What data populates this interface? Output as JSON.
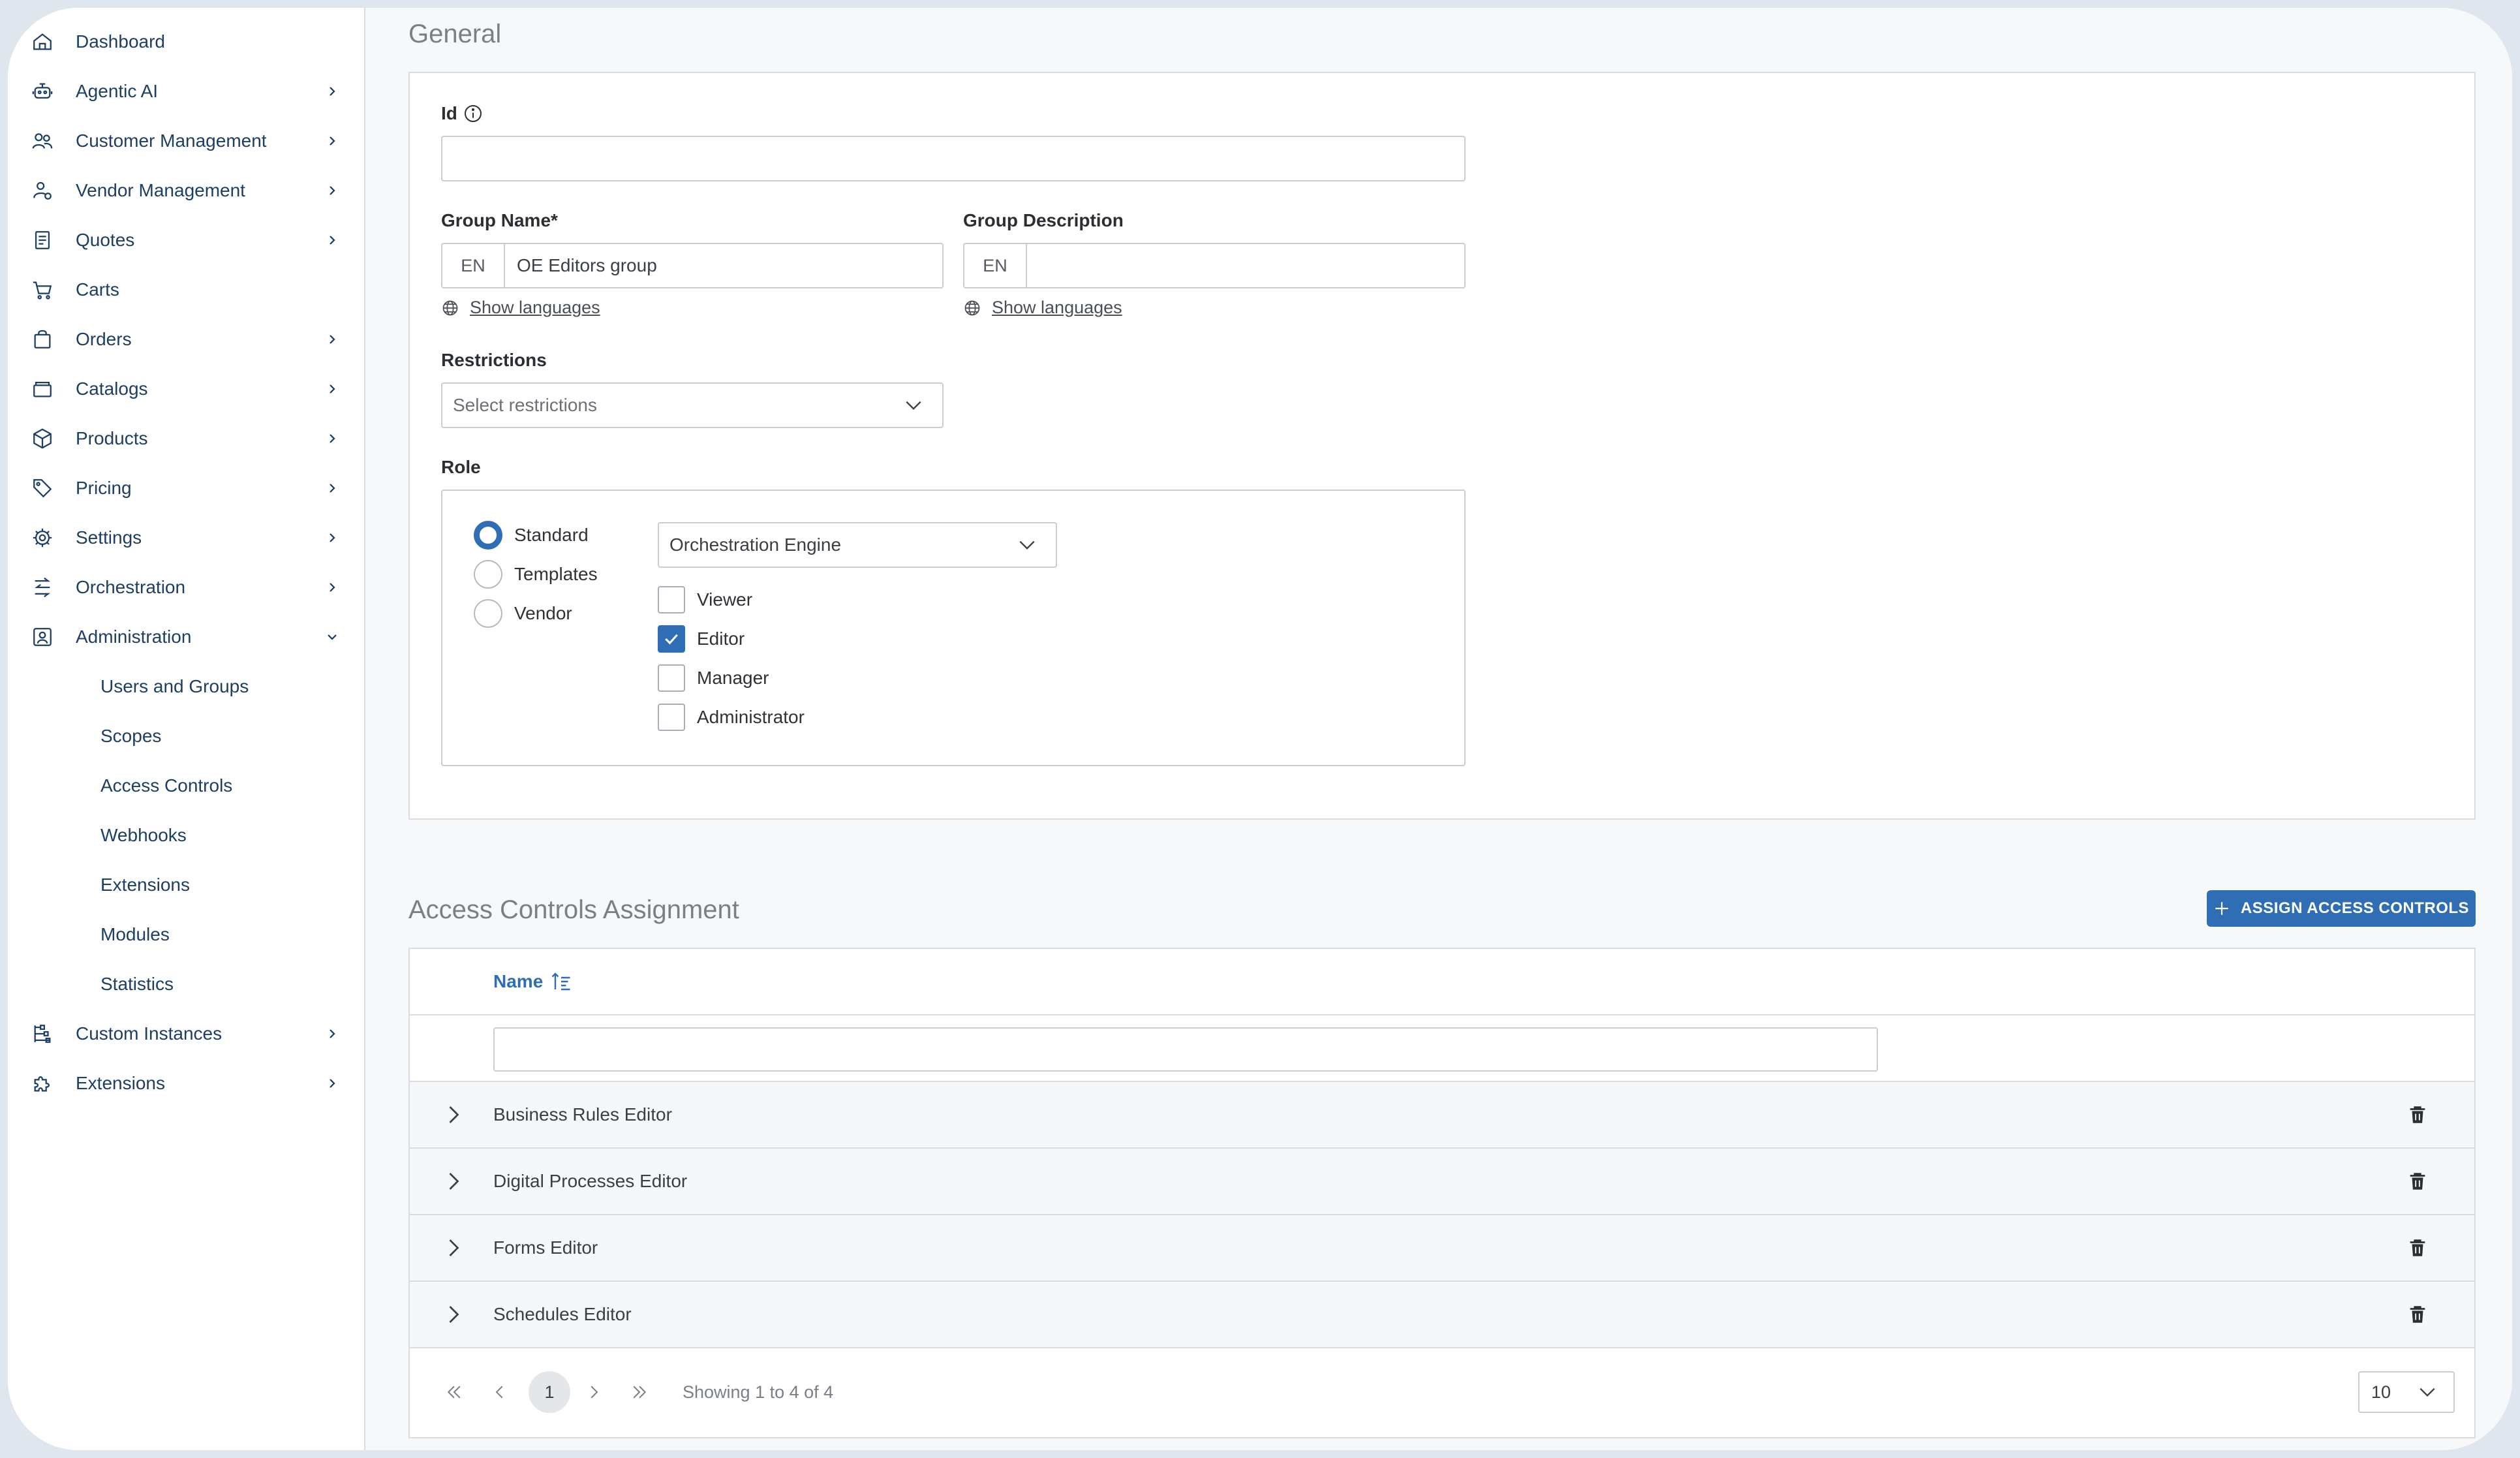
{
  "sidebar": {
    "items": [
      {
        "label": "Dashboard",
        "icon": "home-icon",
        "has_children": false
      },
      {
        "label": "Agentic AI",
        "icon": "robot-icon",
        "has_children": true
      },
      {
        "label": "Customer Management",
        "icon": "users-icon",
        "has_children": true
      },
      {
        "label": "Vendor Management",
        "icon": "vendor-icon",
        "has_children": true
      },
      {
        "label": "Quotes",
        "icon": "document-icon",
        "has_children": true
      },
      {
        "label": "Carts",
        "icon": "cart-icon",
        "has_children": false
      },
      {
        "label": "Orders",
        "icon": "bag-icon",
        "has_children": true
      },
      {
        "label": "Catalogs",
        "icon": "catalog-icon",
        "has_children": true
      },
      {
        "label": "Products",
        "icon": "box-icon",
        "has_children": true
      },
      {
        "label": "Pricing",
        "icon": "tag-icon",
        "has_children": true
      },
      {
        "label": "Settings",
        "icon": "gear-icon",
        "has_children": true
      },
      {
        "label": "Orchestration",
        "icon": "orchestration-icon",
        "has_children": true
      },
      {
        "label": "Administration",
        "icon": "admin-icon",
        "has_children": true,
        "expanded": true
      }
    ],
    "admin_subitems": [
      "Users and Groups",
      "Scopes",
      "Access Controls",
      "Webhooks",
      "Extensions",
      "Modules",
      "Statistics"
    ],
    "bottom_items": [
      {
        "label": "Custom Instances",
        "icon": "hierarchy-icon",
        "has_children": true
      },
      {
        "label": "Extensions",
        "icon": "puzzle-icon",
        "has_children": true
      }
    ]
  },
  "general": {
    "title": "General",
    "id_label": "Id",
    "id_value": "",
    "group_name_label": "Group Name*",
    "group_name_lang": "EN",
    "group_name_value": "OE Editors group",
    "group_desc_label": "Group Description",
    "group_desc_lang": "EN",
    "group_desc_value": "",
    "show_languages": "Show languages",
    "restrictions_label": "Restrictions",
    "restrictions_placeholder": "Select restrictions",
    "role_label": "Role",
    "role_options": [
      {
        "label": "Standard",
        "checked": true
      },
      {
        "label": "Templates",
        "checked": false
      },
      {
        "label": "Vendor",
        "checked": false
      }
    ],
    "role_module": "Orchestration Engine",
    "permissions": [
      {
        "label": "Viewer",
        "checked": false
      },
      {
        "label": "Editor",
        "checked": true
      },
      {
        "label": "Manager",
        "checked": false
      },
      {
        "label": "Administrator",
        "checked": false
      }
    ]
  },
  "access_controls": {
    "title": "Access Controls Assignment",
    "assign_button": "ASSIGN ACCESS CONTROLS",
    "column_name": "Name",
    "filter_value": "",
    "rows": [
      "Business Rules Editor",
      "Digital Processes Editor",
      "Forms Editor",
      "Schedules Editor"
    ],
    "pager": {
      "current_page": "1",
      "summary": "Showing 1 to 4 of 4",
      "page_size": "10"
    }
  },
  "colors": {
    "accent": "#2f6db5",
    "nav_text": "#1c3f63",
    "muted": "#7b8086"
  }
}
